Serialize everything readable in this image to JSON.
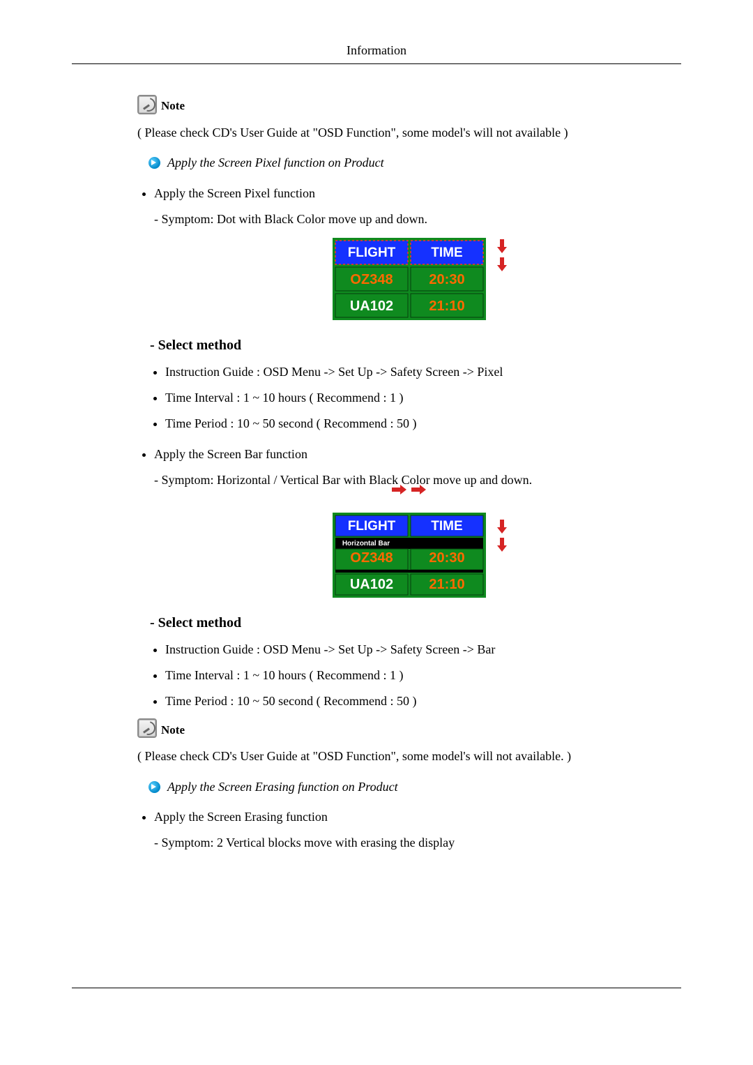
{
  "header": "Information",
  "note_label": "Note",
  "note1_text": "( Please check CD's User Guide at \"OSD Function\", some model's will not available )",
  "note2_text": "( Please check CD's User Guide at \"OSD Function\", some model's will not available. )",
  "apply_pixel_heading": "Apply the Screen Pixel function on Product",
  "apply_pixel_item": "Apply the Screen Pixel function",
  "pixel_symptom": "- Symptom: Dot with Black Color move up and down.",
  "select_method": "- Select method",
  "pixel_methods": [
    "Instruction Guide : OSD Menu -> Set Up -> Safety Screen -> Pixel",
    "Time Interval : 1 ~ 10 hours ( Recommend : 1 )",
    "Time Period : 10 ~ 50 second ( Recommend : 50 )"
  ],
  "apply_bar_item": "Apply the Screen Bar function",
  "bar_symptom": "- Symptom: Horizontal / Vertical Bar with Black Color move up and down.",
  "bar_methods": [
    "Instruction Guide : OSD Menu -> Set Up -> Safety Screen -> Bar",
    "Time Interval : 1 ~ 10 hours ( Recommend : 1 )",
    "Time Period : 10 ~ 50 second ( Recommend : 50 )"
  ],
  "apply_erasing_heading": "Apply the Screen Erasing function on Product",
  "apply_erasing_item": "Apply the Screen Erasing function",
  "erasing_symptom": "- Symptom: 2 Vertical blocks move with erasing the display",
  "board": {
    "col1": "FLIGHT",
    "col2": "TIME",
    "r1c1": "OZ348",
    "r1c2": "20:30",
    "r2c1": "UA102",
    "r2c2": "21:10",
    "hbar": "Horizontal Bar"
  }
}
